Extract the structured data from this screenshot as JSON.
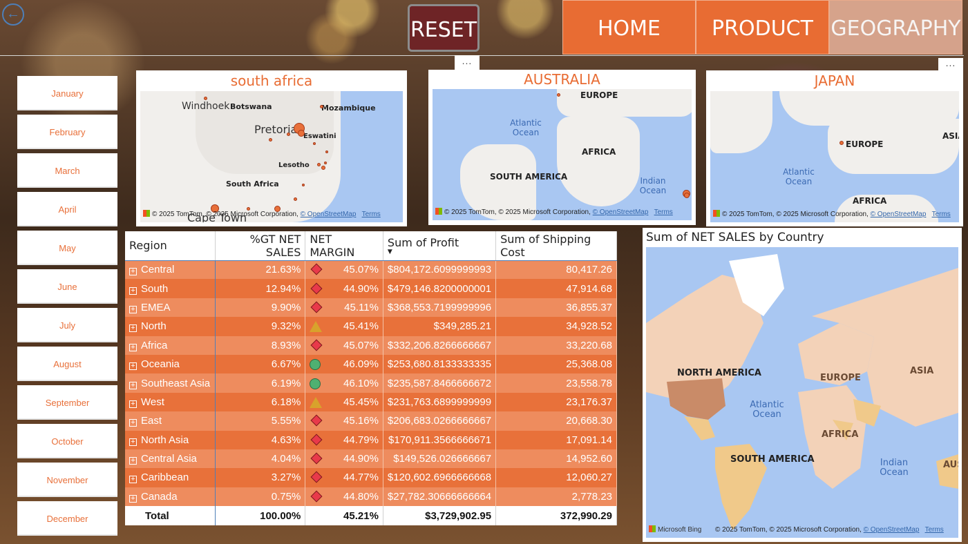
{
  "nav": {
    "reset_label": "RESET",
    "more_label": "...",
    "home_label": "HOME",
    "product_label": "PRODUCT",
    "geography_label": "GEOGRAPHY"
  },
  "months": [
    "January",
    "February",
    "March",
    "April",
    "May",
    "June",
    "July",
    "August",
    "September",
    "October",
    "November",
    "December"
  ],
  "maps": {
    "south_africa": {
      "title": "south africa",
      "labels": [
        "Windhoek",
        "Botswana",
        "Mozambique",
        "Pretoria",
        "Eswatini",
        "Lesotho",
        "South Africa",
        "Cape Town"
      ]
    },
    "australia": {
      "title": "AUSTRALIA",
      "labels": [
        "EUROPE",
        "Atlantic Ocean",
        "AFRICA",
        "SOUTH AMERICA",
        "Indian Ocean"
      ]
    },
    "japan": {
      "title": "JAPAN",
      "labels": [
        "ASIA",
        "EUROPE",
        "Atlantic Ocean",
        "AFRICA"
      ]
    },
    "world": {
      "title": "Sum of NET SALES by Country",
      "labels": [
        "NORTH AMERICA",
        "EUROPE",
        "ASIA",
        "Atlantic Ocean",
        "AFRICA",
        "SOUTH AMERICA",
        "Indian Ocean",
        "AUS"
      ],
      "bing": "Microsoft Bing"
    },
    "attribution_prefix": "© 2025 TomTom, © 2025 Microsoft Corporation, ",
    "attribution_osm": "© OpenStreetMap",
    "attribution_terms": "Terms",
    "microsoft_label": "Microsoft"
  },
  "table": {
    "headers": [
      "Region",
      "%GT NET SALES",
      "NET MARGIN",
      "Sum of Profit",
      "Sum of Shipping Cost"
    ],
    "rows": [
      {
        "region": "Central",
        "gt": "21.63%",
        "kpi": "diamond",
        "margin": "45.07%",
        "profit": "$804,172.6099999993",
        "ship": "80,417.26"
      },
      {
        "region": "South",
        "gt": "12.94%",
        "kpi": "diamond",
        "margin": "44.90%",
        "profit": "$479,146.8200000001",
        "ship": "47,914.68"
      },
      {
        "region": "EMEA",
        "gt": "9.90%",
        "kpi": "diamond",
        "margin": "45.11%",
        "profit": "$368,553.7199999996",
        "ship": "36,855.37"
      },
      {
        "region": "North",
        "gt": "9.32%",
        "kpi": "tri",
        "margin": "45.41%",
        "profit": "$349,285.21",
        "ship": "34,928.52"
      },
      {
        "region": "Africa",
        "gt": "8.93%",
        "kpi": "diamond",
        "margin": "45.07%",
        "profit": "$332,206.8266666667",
        "ship": "33,220.68"
      },
      {
        "region": "Oceania",
        "gt": "6.67%",
        "kpi": "circle",
        "margin": "46.09%",
        "profit": "$253,680.8133333335",
        "ship": "25,368.08"
      },
      {
        "region": "Southeast Asia",
        "gt": "6.19%",
        "kpi": "circle",
        "margin": "46.10%",
        "profit": "$235,587.8466666672",
        "ship": "23,558.78"
      },
      {
        "region": "West",
        "gt": "6.18%",
        "kpi": "tri",
        "margin": "45.45%",
        "profit": "$231,763.6899999999",
        "ship": "23,176.37"
      },
      {
        "region": "East",
        "gt": "5.55%",
        "kpi": "diamond",
        "margin": "45.16%",
        "profit": "$206,683.0266666667",
        "ship": "20,668.30"
      },
      {
        "region": "North Asia",
        "gt": "4.63%",
        "kpi": "diamond",
        "margin": "44.79%",
        "profit": "$170,911.3566666671",
        "ship": "17,091.14"
      },
      {
        "region": "Central Asia",
        "gt": "4.04%",
        "kpi": "diamond",
        "margin": "44.90%",
        "profit": "$149,526.026666667",
        "ship": "14,952.60"
      },
      {
        "region": "Caribbean",
        "gt": "3.27%",
        "kpi": "diamond",
        "margin": "44.77%",
        "profit": "$120,602.6966666668",
        "ship": "12,060.27"
      },
      {
        "region": "Canada",
        "gt": "0.75%",
        "kpi": "diamond",
        "margin": "44.80%",
        "profit": "$27,782.30666666664",
        "ship": "2,778.23"
      }
    ],
    "total": {
      "label": "Total",
      "gt": "100.00%",
      "margin": "45.21%",
      "profit": "$3,729,902.95",
      "ship": "372,990.29"
    }
  },
  "colors": {
    "accent": "#e86c33",
    "reset": "#6e2426",
    "row_light": "#ee8c5e",
    "row_dark": "#e8713a",
    "kpi_bad": "#e8394a",
    "kpi_warn": "#d8a22c",
    "kpi_good": "#4fb071"
  }
}
